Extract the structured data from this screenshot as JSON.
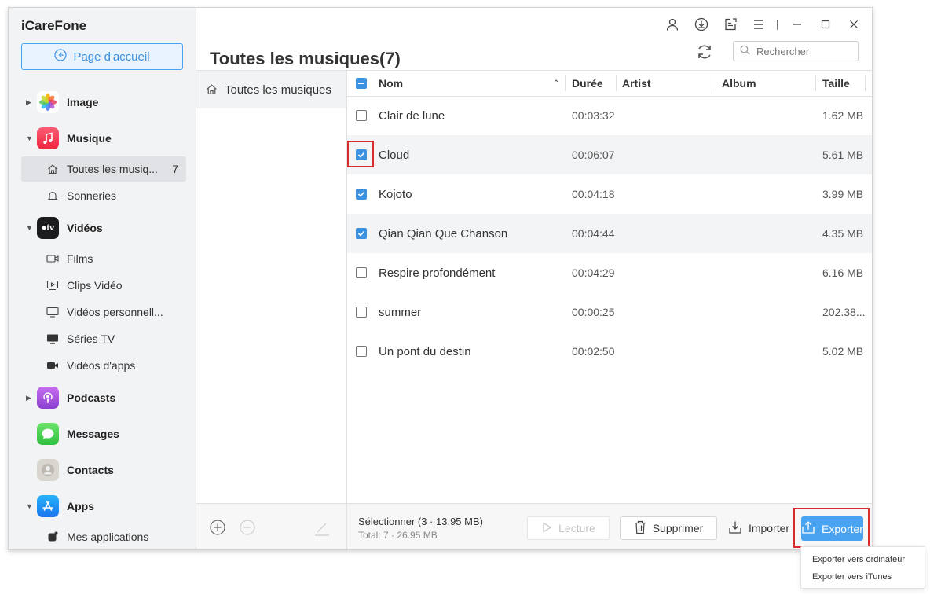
{
  "app": {
    "title": "iCareFone"
  },
  "home_button": {
    "label": "Page d'accueil"
  },
  "sidebar": {
    "categories": [
      {
        "label": "Image"
      },
      {
        "label": "Musique"
      },
      {
        "label": "Vidéos"
      },
      {
        "label": "Podcasts"
      },
      {
        "label": "Messages"
      },
      {
        "label": "Contacts"
      },
      {
        "label": "Apps"
      }
    ],
    "music_items": [
      {
        "label": "Toutes les musiq...",
        "count": "7"
      },
      {
        "label": "Sonneries"
      }
    ],
    "video_items": [
      {
        "label": "Films"
      },
      {
        "label": "Clips Vidéo"
      },
      {
        "label": "Vidéos personnell..."
      },
      {
        "label": "Séries TV"
      },
      {
        "label": "Vidéos d'apps"
      }
    ],
    "app_items": [
      {
        "label": "Mes applications"
      }
    ]
  },
  "header": {
    "title": "Toutes les musiques(7)"
  },
  "search": {
    "placeholder": "Rechercher"
  },
  "subpanel": {
    "selected_label": "Toutes les musiques"
  },
  "table": {
    "columns": {
      "name": "Nom",
      "duration": "Durée",
      "artist": "Artist",
      "album": "Album",
      "size": "Taille"
    },
    "rows": [
      {
        "name": "Clair de lune",
        "duration": "00:03:32",
        "artist": "",
        "album": "",
        "size": "1.62 MB",
        "checked": false
      },
      {
        "name": "Cloud",
        "duration": "00:06:07",
        "artist": "",
        "album": "",
        "size": "5.61 MB",
        "checked": true
      },
      {
        "name": "Kojoto",
        "duration": "00:04:18",
        "artist": "",
        "album": "",
        "size": "3.99 MB",
        "checked": true
      },
      {
        "name": "Qian Qian Que Chanson",
        "duration": "00:04:44",
        "artist": "",
        "album": "",
        "size": "4.35 MB",
        "checked": true
      },
      {
        "name": "Respire profondément",
        "duration": "00:04:29",
        "artist": "",
        "album": "",
        "size": "6.16 MB",
        "checked": false
      },
      {
        "name": "summer",
        "duration": "00:00:25",
        "artist": "",
        "album": "",
        "size": "202.38...",
        "checked": false
      },
      {
        "name": "Un pont du destin",
        "duration": "00:02:50",
        "artist": "",
        "album": "",
        "size": "5.02 MB",
        "checked": false
      }
    ]
  },
  "footer": {
    "selected_text": "Sélectionner (3 · 13.95 MB)",
    "total_text": "Total: 7 · 26.95 MB",
    "play_label": "Lecture",
    "delete_label": "Supprimer",
    "import_label": "Importer",
    "export_label": "Exporter"
  },
  "export_menu": {
    "items": [
      "Exporter vers ordinateur",
      "Exporter vers iTunes"
    ]
  },
  "colors": {
    "accent": "#4aa3f0",
    "checkbox": "#3d92e0",
    "highlight_border": "#d92b2b"
  }
}
